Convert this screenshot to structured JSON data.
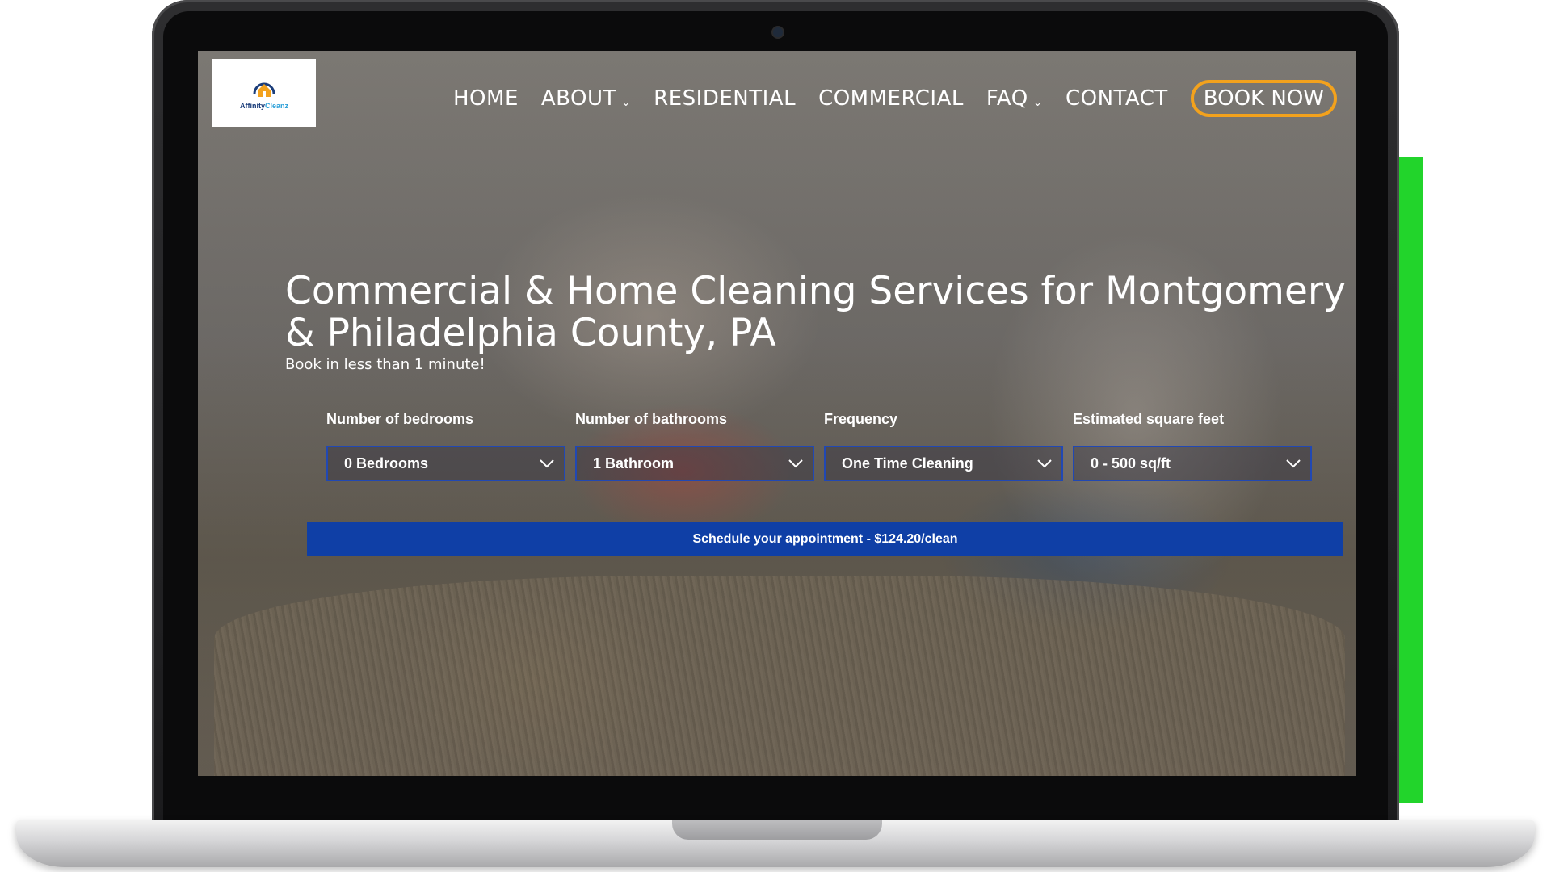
{
  "brand": {
    "logo_text_primary": "Affinity",
    "logo_text_accent": "Cleanz",
    "accent_color": "#f3a21d",
    "primary_color": "#0f3fa6"
  },
  "nav": {
    "items": [
      {
        "label": "HOME",
        "dropdown": false
      },
      {
        "label": "ABOUT",
        "dropdown": true
      },
      {
        "label": "RESIDENTIAL",
        "dropdown": false
      },
      {
        "label": "COMMERCIAL",
        "dropdown": false
      },
      {
        "label": "FAQ",
        "dropdown": true
      },
      {
        "label": "CONTACT",
        "dropdown": false
      }
    ],
    "book_label": "BOOK NOW"
  },
  "hero": {
    "title": "Commercial & Home Cleaning Services for Montgomery & Philadelphia County, PA",
    "subtitle": "Book in less than 1 minute!"
  },
  "form": {
    "fields": [
      {
        "label": "Number of bedrooms",
        "value": "0 Bedrooms"
      },
      {
        "label": "Number of bathrooms",
        "value": "1 Bathroom"
      },
      {
        "label": "Frequency",
        "value": "One Time Cleaning"
      },
      {
        "label": "Estimated square feet",
        "value": "0 - 500 sq/ft"
      }
    ],
    "cta_label": "Schedule your appointment - $124.20/clean"
  }
}
